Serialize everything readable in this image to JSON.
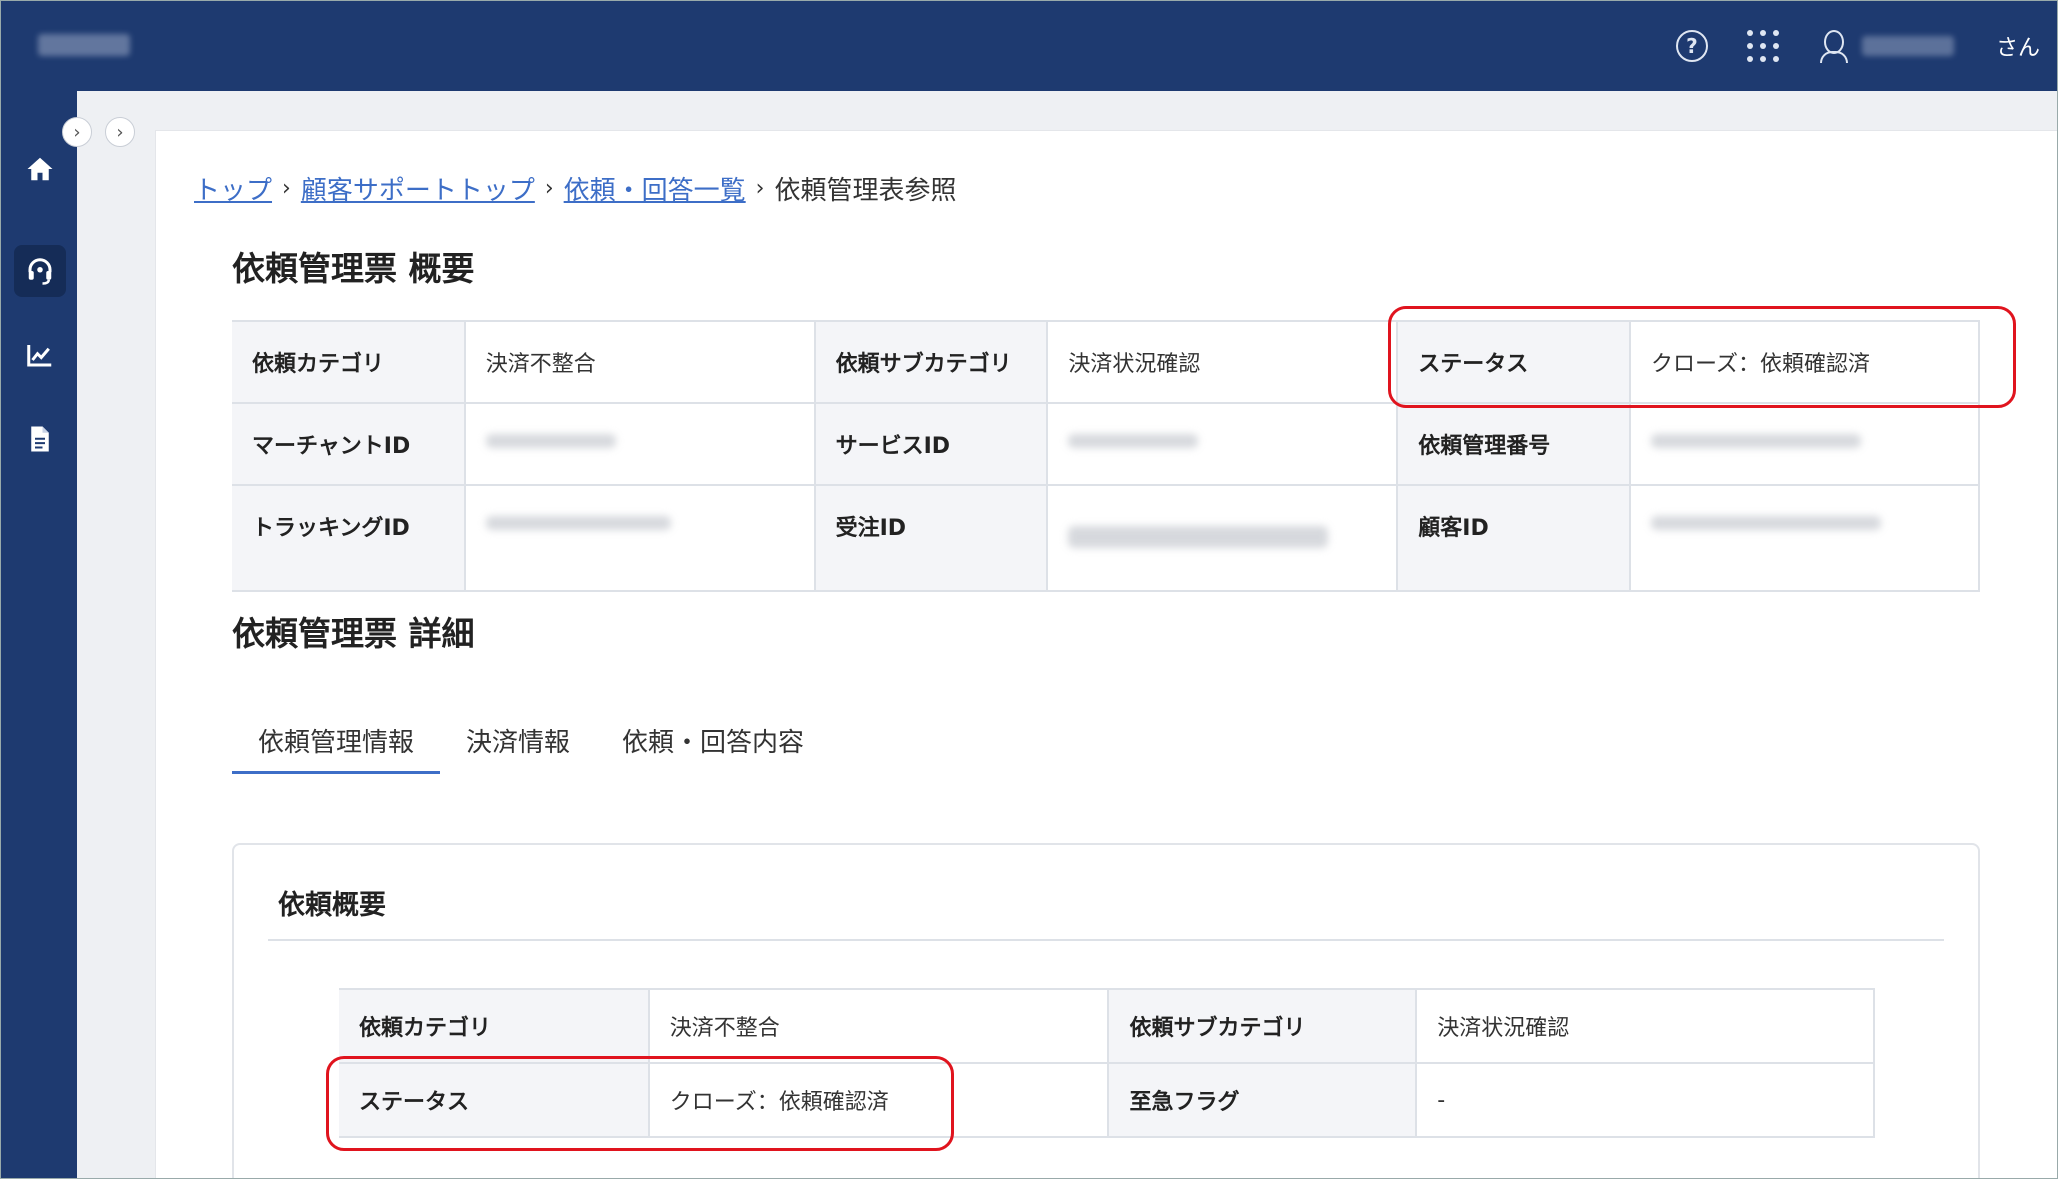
{
  "header": {
    "user_suffix": "さん",
    "icons": [
      "help-icon",
      "apps-grid-icon",
      "user-icon"
    ]
  },
  "sidebar": {
    "items": [
      {
        "name": "home",
        "icon": "home-icon"
      },
      {
        "name": "support",
        "icon": "headset-icon",
        "active": true
      },
      {
        "name": "analytics",
        "icon": "chart-icon"
      },
      {
        "name": "documents",
        "icon": "document-icon"
      }
    ]
  },
  "breadcrumb": {
    "items": [
      {
        "label": "トップ"
      },
      {
        "label": "顧客サポートトップ"
      },
      {
        "label": "依頼・回答一覧"
      }
    ],
    "current": "依頼管理表参照"
  },
  "overview": {
    "title": "依頼管理票 概要",
    "rows": [
      [
        {
          "label": "依頼カテゴリ",
          "value": "決済不整合"
        },
        {
          "label": "依頼サブカテゴリ",
          "value": "決済状況確認"
        },
        {
          "label": "ステータス",
          "value": "クローズ：依頼確認済"
        }
      ],
      [
        {
          "label": "マーチャントID",
          "value": ""
        },
        {
          "label": "サービスID",
          "value": ""
        },
        {
          "label": "依頼管理番号",
          "value": ""
        }
      ],
      [
        {
          "label": "トラッキングID",
          "value": ""
        },
        {
          "label": "受注ID",
          "value": ""
        },
        {
          "label": "顧客ID",
          "value": ""
        }
      ]
    ]
  },
  "detail": {
    "title": "依頼管理票 詳細",
    "tabs": [
      {
        "label": "依頼管理情報",
        "active": true
      },
      {
        "label": "決済情報"
      },
      {
        "label": "依頼・回答内容"
      }
    ],
    "card_title": "依頼概要",
    "rows": [
      [
        {
          "label": "依頼カテゴリ",
          "value": "決済不整合"
        },
        {
          "label": "依頼サブカテゴリ",
          "value": "決済状況確認"
        }
      ],
      [
        {
          "label": "ステータス",
          "value": "クローズ：依頼確認済"
        },
        {
          "label": "至急フラグ",
          "value": "-"
        }
      ]
    ]
  },
  "colors": {
    "header_bg": "#1e3a70",
    "link": "#3d6ec7",
    "highlight": "#e0141e"
  }
}
